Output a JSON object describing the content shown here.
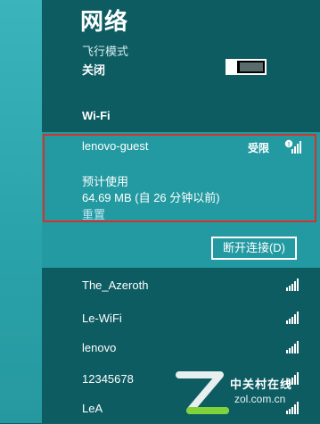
{
  "header": {
    "title": "网络"
  },
  "airplane": {
    "label": "飞行模式",
    "state": "关闭"
  },
  "wifi": {
    "heading": "Wi-Fi"
  },
  "selected_network": {
    "name": "lenovo-guest",
    "badge": "受限",
    "usage_label": "预计使用",
    "usage_value": "64.69 MB (自 26 分钟以前)",
    "reset_link": "重置",
    "disconnect_label": "断开连接(D)"
  },
  "networks": [
    {
      "name": "The_Azeroth",
      "signal": "signal-icon"
    },
    {
      "name": "Le-WiFi",
      "signal": "signal-icon"
    },
    {
      "name": "lenovo",
      "signal": "signal-icon"
    },
    {
      "name": "12345678",
      "signal": "signal-icon"
    },
    {
      "name": "LeA",
      "signal": "signal-icon"
    }
  ],
  "watermark": {
    "line1": "中关村在线",
    "line2": "zol.com.cn"
  },
  "colors": {
    "panel": "#0d5c62",
    "selected": "#239aa1",
    "accent_strip": "#3bb4bb",
    "highlight": "#d2332c"
  }
}
